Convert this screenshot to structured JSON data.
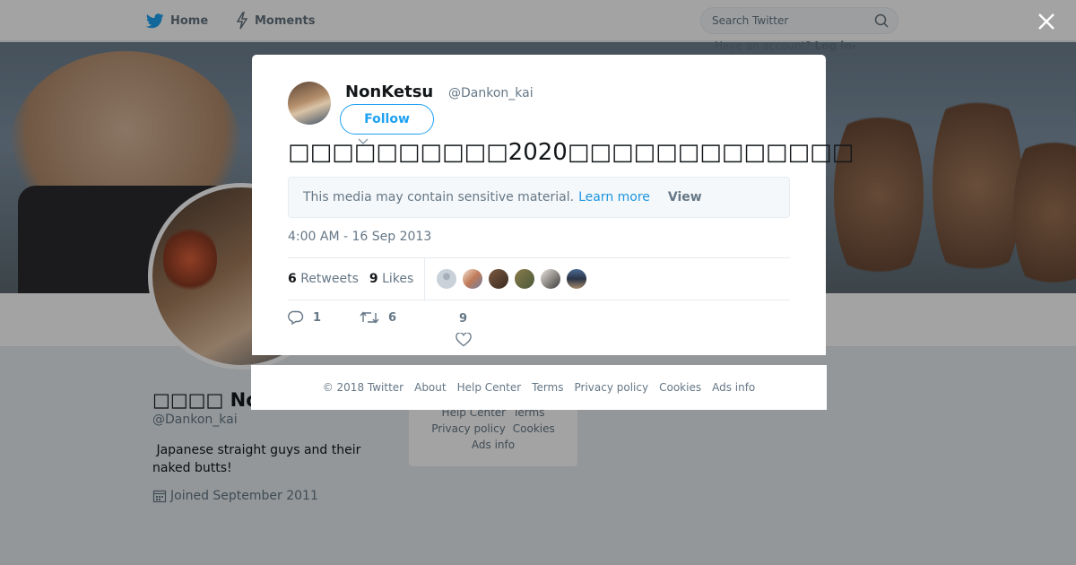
{
  "topbar": {
    "home_label": "Home",
    "moments_label": "Moments",
    "search_placeholder": "Search Twitter",
    "have_account": "Have an account?",
    "login_label": "Log in"
  },
  "profile": {
    "name": "□□□□ NonKetsu",
    "handle": "@Dankon_kai",
    "bio": " Japanese straight guys and their naked butts!",
    "joined": "Joined September 2011"
  },
  "side_footer": {
    "help_center": "Help Center",
    "terms": "Terms",
    "privacy": "Privacy policy",
    "cookies": "Cookies",
    "ads_info": "Ads info"
  },
  "tweet": {
    "author_name": "NonKetsu",
    "author_handle": "@Dankon_kai",
    "follow_label": "Follow",
    "text": "□□□□□□□□□□2020□□□□□□□□□□□□□",
    "sensitive_notice": "This media may contain sensitive material.",
    "learn_more": "Learn more",
    "view_label": "View",
    "timestamp": "4:00 AM - 16 Sep 2013",
    "retweets_count": "6",
    "retweets_label": "Retweets",
    "likes_count": "9",
    "likes_label": "Likes",
    "reply_count": "1",
    "retweet_action_count": "6",
    "like_action_count": "9"
  },
  "modal_footer": {
    "copyright": "© 2018 Twitter",
    "about": "About",
    "help_center": "Help Center",
    "terms": "Terms",
    "privacy": "Privacy policy",
    "cookies": "Cookies",
    "ads_info": "Ads info"
  },
  "colors": {
    "accent": "#1da1f2",
    "link": "#1b95e0",
    "muted": "#657786"
  }
}
